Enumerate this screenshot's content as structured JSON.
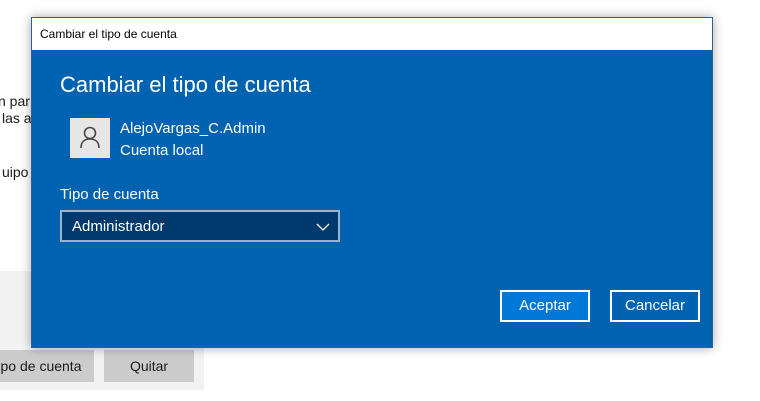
{
  "background": {
    "text_line1": "n par",
    "text_line2": "las a",
    "text_line3": "uipo",
    "change_type_button": "po de cuenta",
    "remove_button": "Quitar"
  },
  "dialog": {
    "window_title": "Cambiar el tipo de cuenta",
    "heading": "Cambiar el tipo de cuenta",
    "user": {
      "name": "AlejoVargas_C.Admin",
      "account_kind": "Cuenta local",
      "avatar_icon": "person-icon"
    },
    "account_type": {
      "label": "Tipo de cuenta",
      "selected": "Administrador"
    },
    "buttons": {
      "accept": "Aceptar",
      "cancel": "Cancelar"
    }
  },
  "colors": {
    "dialog_blue": "#0063b1",
    "accent_button": "#0078d7",
    "select_bg": "#003a6d"
  }
}
